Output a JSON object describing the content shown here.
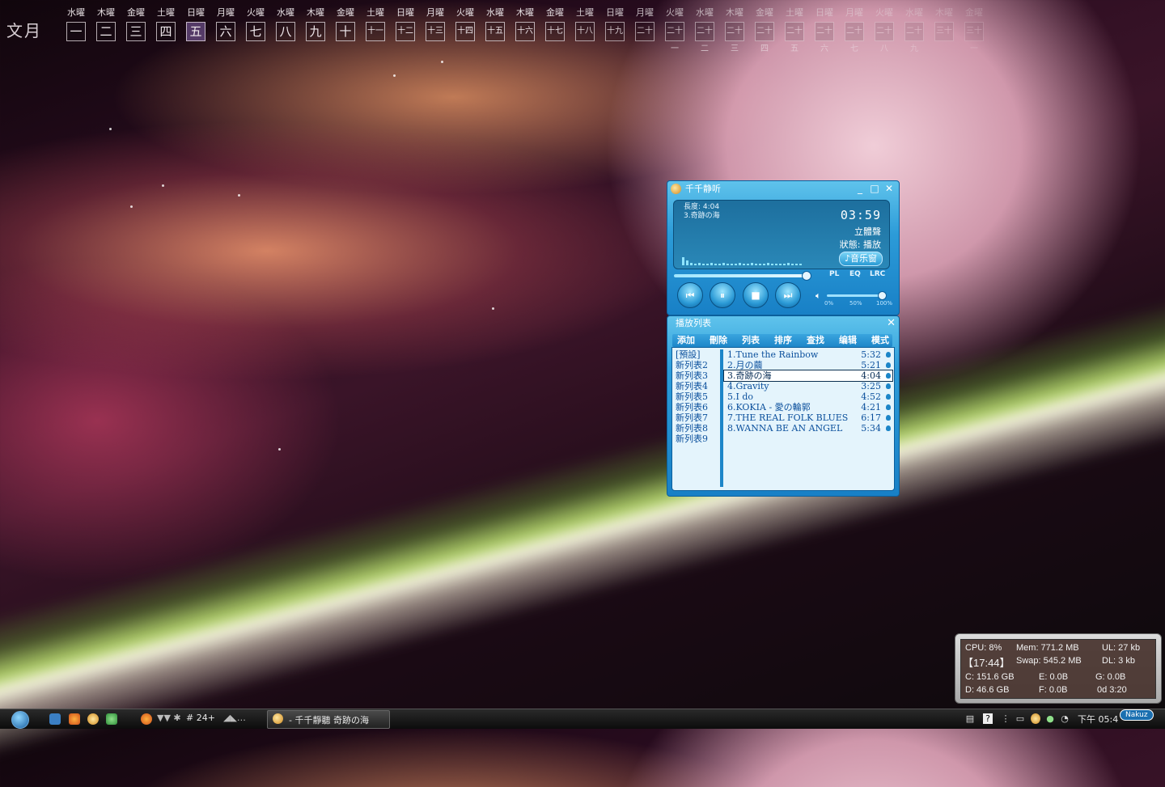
{
  "calendar": {
    "month": "文月",
    "days": [
      {
        "dow": "水曜",
        "num": "一"
      },
      {
        "dow": "木曜",
        "num": "二"
      },
      {
        "dow": "金曜",
        "num": "三"
      },
      {
        "dow": "土曜",
        "num": "四"
      },
      {
        "dow": "日曜",
        "num": "五"
      },
      {
        "dow": "月曜",
        "num": "六"
      },
      {
        "dow": "火曜",
        "num": "七"
      },
      {
        "dow": "水曜",
        "num": "八"
      },
      {
        "dow": "木曜",
        "num": "九"
      },
      {
        "dow": "金曜",
        "num": "十"
      },
      {
        "dow": "土曜",
        "num": "十一"
      },
      {
        "dow": "日曜",
        "num": "十二"
      },
      {
        "dow": "月曜",
        "num": "十三"
      },
      {
        "dow": "火曜",
        "num": "十四"
      },
      {
        "dow": "水曜",
        "num": "十五"
      },
      {
        "dow": "木曜",
        "num": "十六"
      },
      {
        "dow": "金曜",
        "num": "十七"
      },
      {
        "dow": "土曜",
        "num": "十八"
      },
      {
        "dow": "日曜",
        "num": "十九"
      },
      {
        "dow": "月曜",
        "num": "二十"
      },
      {
        "dow": "火曜",
        "num": "二十一"
      },
      {
        "dow": "水曜",
        "num": "二十二"
      },
      {
        "dow": "木曜",
        "num": "二十三"
      },
      {
        "dow": "金曜",
        "num": "二十四"
      },
      {
        "dow": "土曜",
        "num": "二十五"
      },
      {
        "dow": "日曜",
        "num": "二十六"
      },
      {
        "dow": "月曜",
        "num": "二十七"
      },
      {
        "dow": "火曜",
        "num": "二十八"
      },
      {
        "dow": "水曜",
        "num": "二十九"
      },
      {
        "dow": "木曜",
        "num": "三十"
      },
      {
        "dow": "金曜",
        "num": "三十一"
      }
    ],
    "today_index": 4
  },
  "player": {
    "title": "千千静听",
    "display_line1": "長度: 4:04",
    "display_line2": "3.奇跡の海",
    "time": "03:59",
    "channel": "立體聲",
    "status": "狀態: 播放",
    "lyric_button": "♪音乐窗",
    "tabs": [
      "PL",
      "EQ",
      "LRC"
    ],
    "progress": 0.98,
    "volume": 0.92,
    "vol_labels": [
      "0%",
      "50%",
      "100%"
    ],
    "win_buttons": [
      "_",
      "□",
      "✕"
    ],
    "ctrl_icons": [
      "prev-icon",
      "pause-icon",
      "stop-icon",
      "next-icon"
    ],
    "ctrl_glyphs": [
      "⏮",
      "⏸",
      "■",
      "⏭"
    ]
  },
  "playlist": {
    "title": "播放列表",
    "menu": [
      "添加",
      "刪除",
      "列表",
      "排序",
      "查找",
      "编辑",
      "模式"
    ],
    "lists": [
      "[預設]",
      "新列表2",
      "新列表3",
      "新列表4",
      "新列表5",
      "新列表6",
      "新列表7",
      "新列表8",
      "新列表9"
    ],
    "tracks": [
      {
        "title": "1.Tune the Rainbow",
        "dur": "5:32"
      },
      {
        "title": "2.月の繭",
        "dur": "5:21"
      },
      {
        "title": "3.奇跡の海",
        "dur": "4:04"
      },
      {
        "title": "4.Gravity",
        "dur": "3:25"
      },
      {
        "title": "5.I do",
        "dur": "4:52"
      },
      {
        "title": "6.KOKIA - 愛の輪郭",
        "dur": "4:21"
      },
      {
        "title": "7.THE REAL FOLK BLUES",
        "dur": "6:17"
      },
      {
        "title": "8.WANNA BE AN ANGEL",
        "dur": "5:34"
      }
    ],
    "active_index": 2
  },
  "sysmon": {
    "cpu": "CPU:   8%",
    "mem": "Mem:  771.2 MB",
    "ul": "UL:     27 kb",
    "clock": "【17:44】",
    "swap": "Swap: 545.2 MB",
    "dl": "DL:      3 kb",
    "c": "C: 151.6 GB",
    "e": "E:       0.0B",
    "g": "G:      0.0B",
    "d": "D:   46.6 GB",
    "f": "F:       0.0B",
    "uptime": "0d 3:20"
  },
  "taskbar": {
    "tray_text": "# 24+",
    "task_label": "- 千千靜聽  奇跡の海",
    "clock": "下午 05:4",
    "badge": "Nakuz"
  }
}
